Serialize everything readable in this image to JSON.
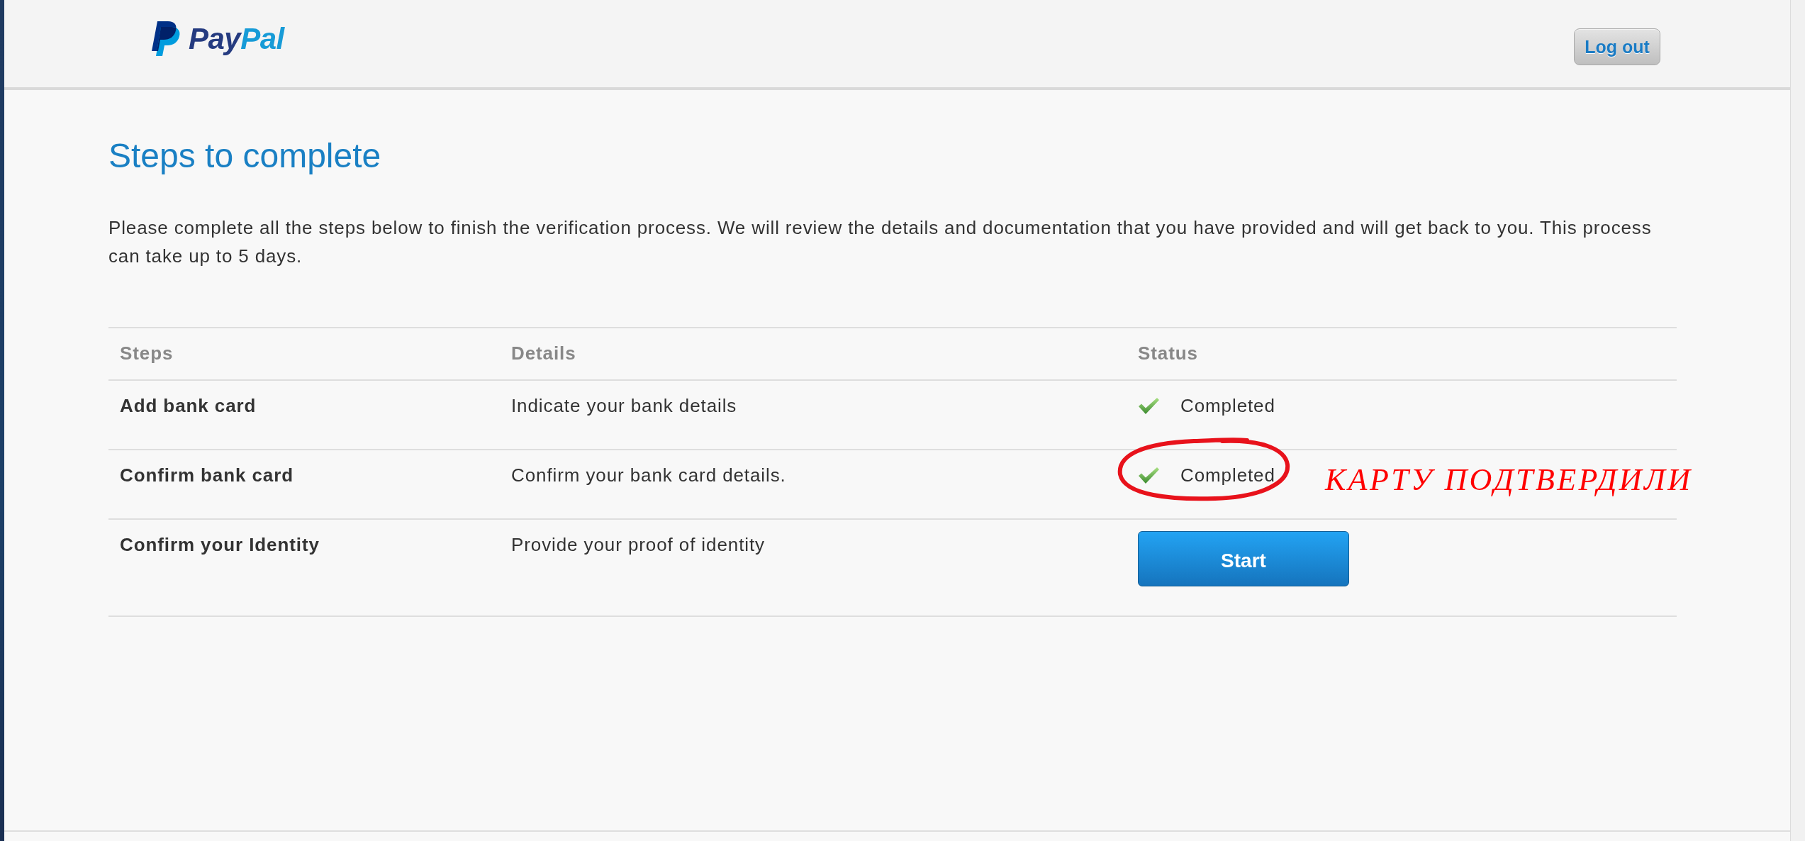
{
  "header": {
    "logo": {
      "wordmark": [
        "Pay",
        "Pal"
      ]
    },
    "logout_button": "Log out"
  },
  "title": "Steps to complete",
  "intro": "Please complete all the steps below to finish the verification process. We will review the details and documentation that you have provided and will get back to you. This process can take up to 5 days.",
  "table": {
    "columns": [
      "Steps",
      "Details",
      "Status"
    ],
    "rows": [
      {
        "step": "Add bank card",
        "details": "Indicate your bank details",
        "status": {
          "kind": "completed",
          "label": "Completed"
        },
        "circled": false
      },
      {
        "step": "Confirm bank card",
        "details": "Confirm your bank card details.",
        "status": {
          "kind": "completed",
          "label": "Completed"
        },
        "circled": true,
        "annotation": "КАРТУ ПОДТВЕРДИЛИ"
      },
      {
        "step": "Confirm your Identity",
        "details": "Provide your proof of identity",
        "status": {
          "kind": "button",
          "label": "Start"
        },
        "circled": false
      }
    ]
  }
}
